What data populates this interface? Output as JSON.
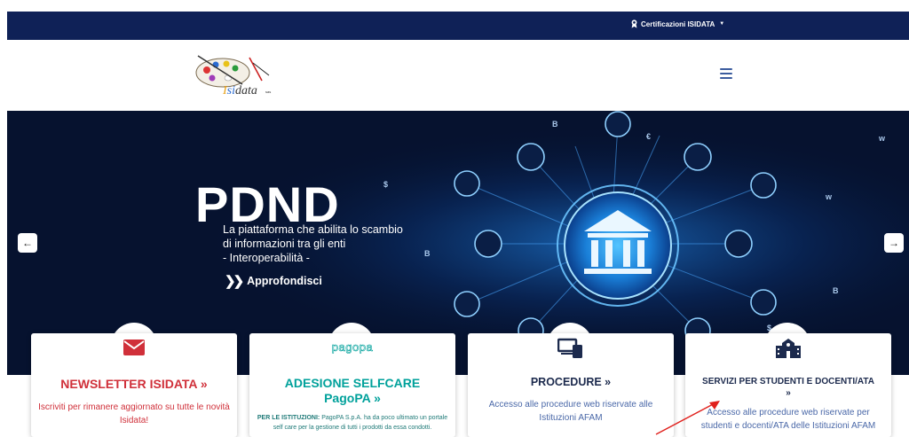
{
  "topbar": {
    "cert_label": "Certificazioni ISIDATA",
    "bg": "#0f2157"
  },
  "header": {
    "logo_text": "Isidata",
    "logo_suffix": "sas"
  },
  "hero": {
    "title": "PDND",
    "lines": [
      "La piattaforma che abilita lo scambio",
      "di informazioni tra gli enti",
      "- Interoperabilità -"
    ],
    "cta": "Approfondisci",
    "prev": "←",
    "next": "→"
  },
  "cards": [
    {
      "title": "NEWSLETTER ISIDATA »",
      "text": "Iscriviti per rimanere aggiornato su tutte le novità Isidata!",
      "color": "#d0303a",
      "icon": "envelope-icon"
    },
    {
      "icon_text": "pagopa",
      "title_line1": "ADESIONE SELFCARE",
      "title_line2": "PagoPA »",
      "strong": "PER LE ISTITUZIONI:",
      "text": " PagoPA S.p.A. ha da poco ultimato un portale self care per la gestione di tutti i prodotti da essa condotti.",
      "color": "#00a19b",
      "icon": "pagopa-logo"
    },
    {
      "title": "PROCEDURE »",
      "text": "Accesso alle procedure web riservate alle Istituzioni AFAM",
      "color": "#1c2a4d",
      "icon": "devices-icon"
    },
    {
      "title": "SERVIZI PER STUDENTI E DOCENTI/ATA",
      "title2": "»",
      "text": "Accesso alle procedure web riservate per studenti e docenti/ATA delle Istituzioni AFAM",
      "color": "#1c2a4d",
      "icon": "school-icon"
    }
  ]
}
